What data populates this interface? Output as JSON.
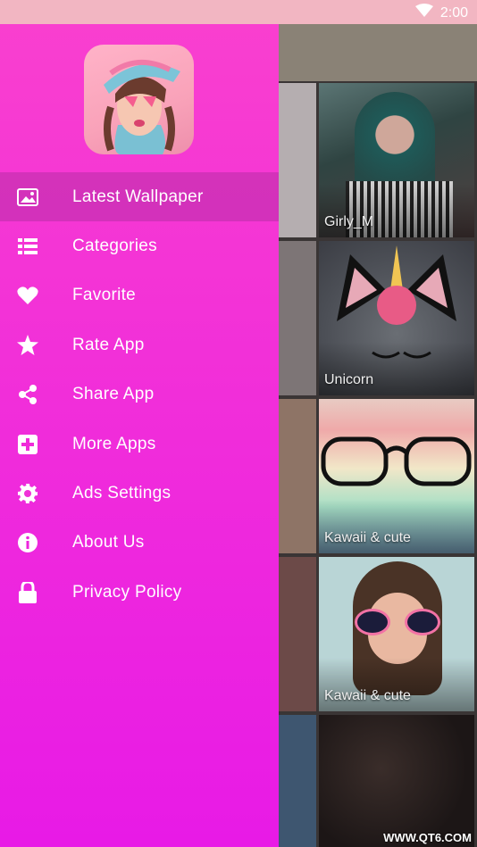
{
  "status_bar": {
    "time": "2:00",
    "wifi_icon": "wifi-icon"
  },
  "drawer": {
    "menu": [
      {
        "label": "Latest Wallpaper",
        "icon": "image-icon",
        "active": true
      },
      {
        "label": "Categories",
        "icon": "list-icon"
      },
      {
        "label": "Favorite",
        "icon": "heart-icon"
      },
      {
        "label": "Rate App",
        "icon": "star-icon"
      },
      {
        "label": "Share App",
        "icon": "share-icon"
      },
      {
        "label": "More Apps",
        "icon": "plus-box-icon"
      },
      {
        "label": "Ads Settings",
        "icon": "gear-icon"
      },
      {
        "label": "About Us",
        "icon": "info-icon"
      },
      {
        "label": "Privacy Policy",
        "icon": "lock-icon"
      }
    ]
  },
  "grid": {
    "tiles": [
      {
        "label": "Girly_M"
      },
      {
        "label": "Unicorn"
      },
      {
        "label": "Kawaii & cute"
      },
      {
        "label": "Kawaii & cute"
      }
    ]
  },
  "watermark": "WWW.QT6.COM",
  "colors": {
    "drawer_top": "#f93fcf",
    "drawer_bottom": "#e81ae6",
    "status_bar": "#f2b6c2",
    "toolbar": "#8a8276"
  }
}
